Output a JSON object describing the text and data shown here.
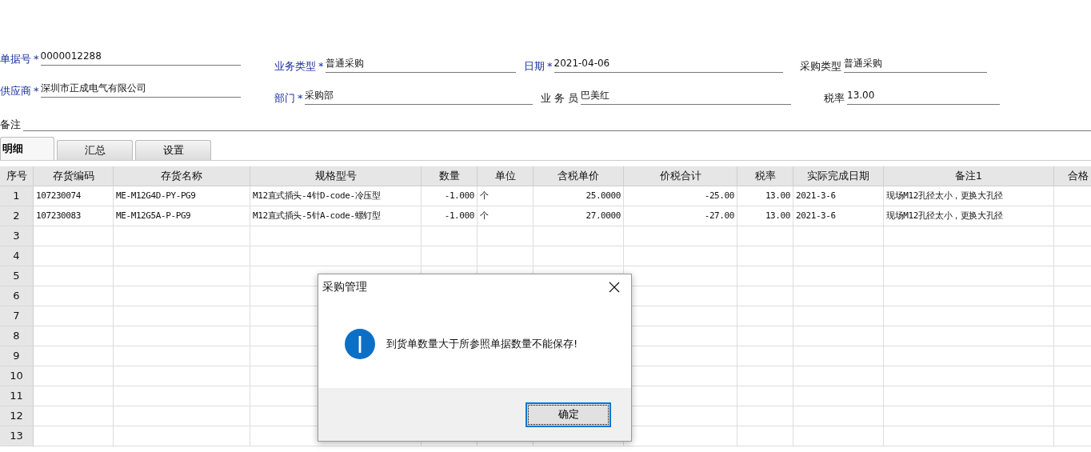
{
  "header": {
    "left": [
      {
        "label": "单据号",
        "required": true,
        "mark": "*",
        "value": "0000012288"
      },
      {
        "label": "供应商",
        "required": true,
        "mark": "*",
        "value": "深圳市正成电气有限公司"
      }
    ],
    "right": [
      {
        "label": "业务类型",
        "required": true,
        "mark": "*",
        "value": "普通采购"
      },
      {
        "label": "日期",
        "required": true,
        "mark": "*",
        "value": "2021-04-06"
      },
      {
        "label": "采购类型",
        "required": false,
        "value": "普通采购"
      },
      {
        "label": "部门",
        "required": true,
        "mark": "*",
        "value": "采购部"
      },
      {
        "label": "业 务 员",
        "required": false,
        "value": "巴美红"
      },
      {
        "label": "税率",
        "required": false,
        "value": "13.00"
      }
    ],
    "remark": {
      "label": "备注"
    }
  },
  "tabs": [
    {
      "label": "明细",
      "selected": true
    },
    {
      "label": "汇总",
      "selected": false
    },
    {
      "label": "设置",
      "selected": false
    }
  ],
  "table": {
    "columns": [
      "序号",
      "存货编码",
      "存货名称",
      "规格型号",
      "数量",
      "单位",
      "含税单价",
      "价税合计",
      "税率",
      "实际完成日期",
      "备注1",
      "合格"
    ],
    "rows": [
      {
        "number": "1",
        "cells": [
          "107230074",
          "ME-M12G4D-PY-PG9",
          "M12直式插头-4针D-code-冷压型",
          "-1.000",
          "个",
          "25.0000",
          "-25.00",
          "13.00",
          "2021-3-6",
          "现场M12孔径太小，更换大孔径"
        ]
      },
      {
        "number": "2",
        "cells": [
          "107230083",
          "ME-M12G5A-P-PG9",
          "M12直式插头-5针A-code-螺钉型",
          "-1.000",
          "个",
          "27.0000",
          "-27.00",
          "13.00",
          "2021-3-6",
          "现场M12孔径太小，更换大孔径"
        ]
      },
      {
        "number": "3"
      },
      {
        "number": "4"
      },
      {
        "number": "5"
      },
      {
        "number": "6"
      },
      {
        "number": "7"
      },
      {
        "number": "8"
      },
      {
        "number": "9"
      },
      {
        "number": "10"
      },
      {
        "number": "11"
      },
      {
        "number": "12"
      },
      {
        "number": "13"
      }
    ]
  },
  "dialog": {
    "title": "采购管理",
    "message": "到货单数量大于所参照单据数量不能保存!",
    "button": "确定"
  }
}
